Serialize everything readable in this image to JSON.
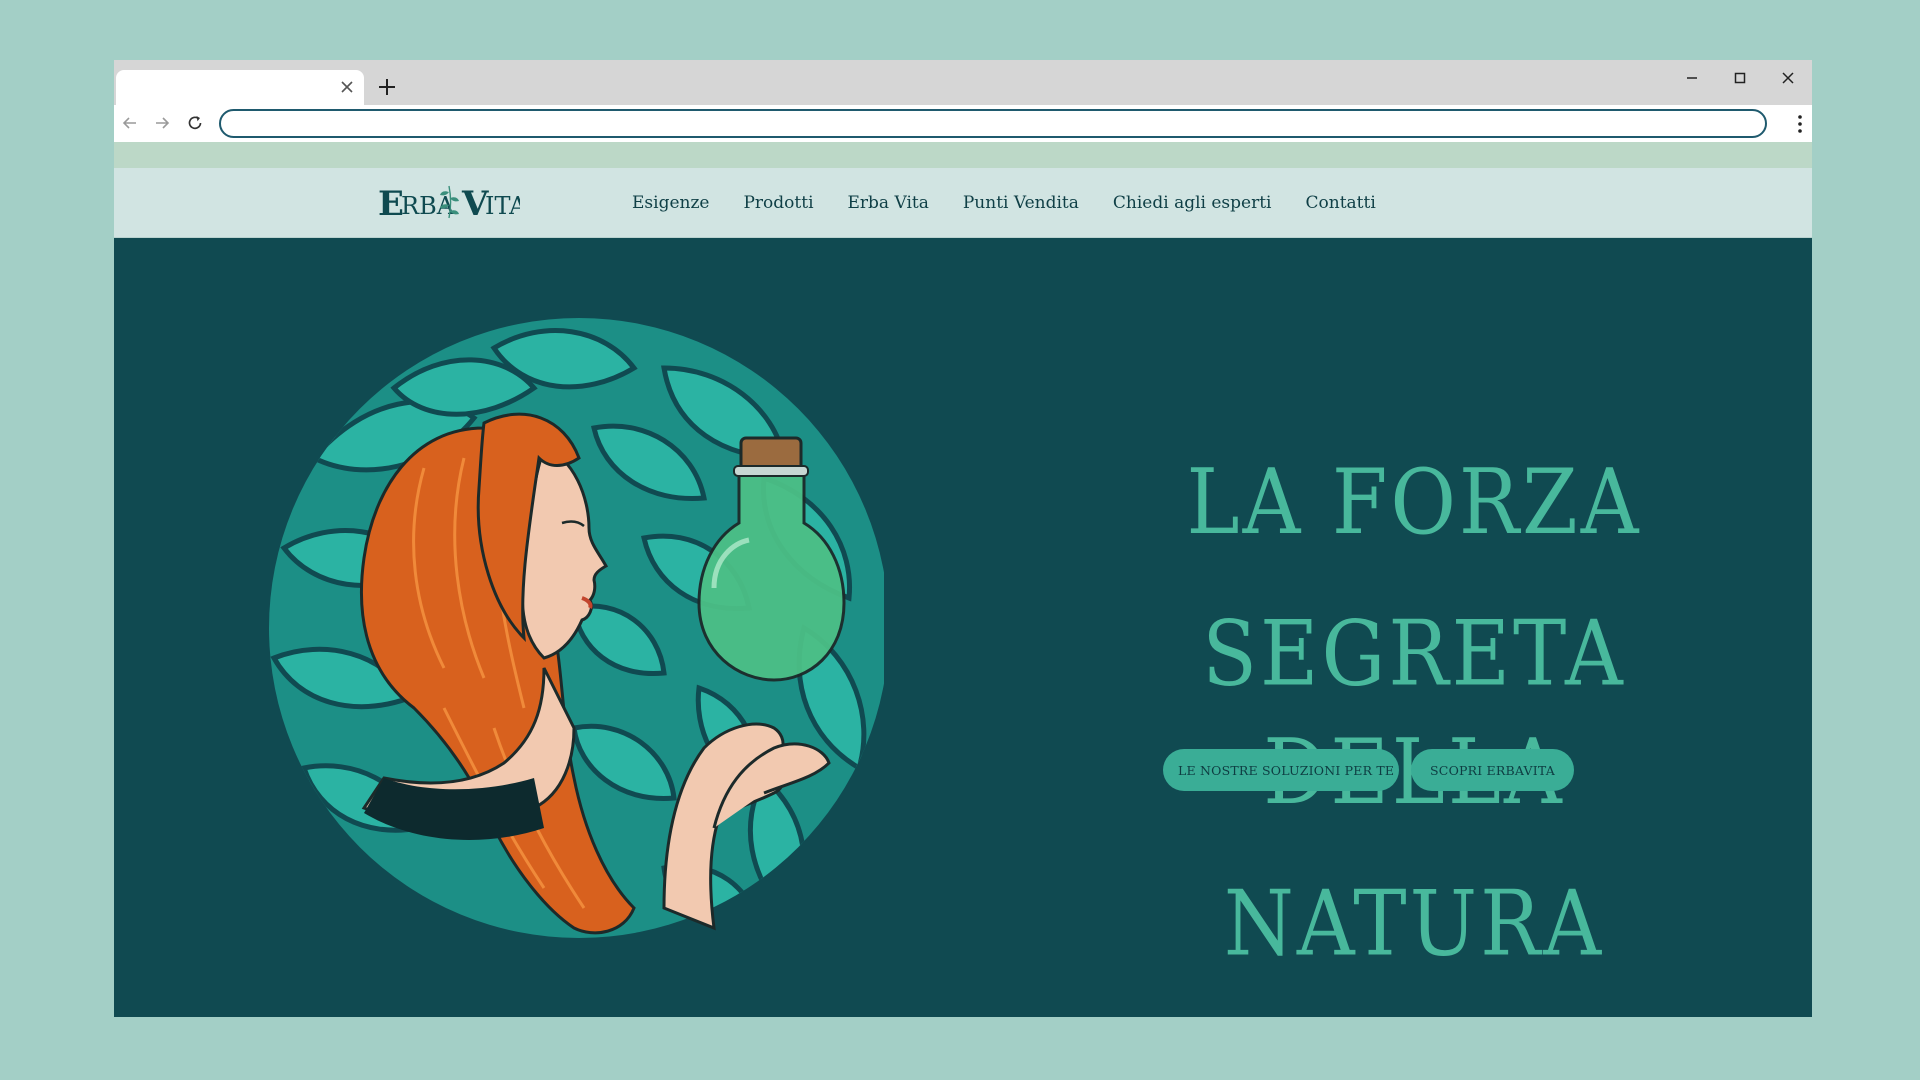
{
  "browser": {
    "tab_title": "",
    "url": "",
    "icons": {
      "tab_close": "close-icon",
      "new_tab": "plus-icon",
      "minimize": "minimize-icon",
      "maximize": "maximize-icon",
      "close": "close-icon",
      "back": "arrow-left-icon",
      "forward": "arrow-right-icon",
      "reload": "reload-icon",
      "menu": "kebab-menu-icon"
    }
  },
  "site": {
    "logo_text": "ErbaVita",
    "nav": [
      {
        "label": "Esigenze"
      },
      {
        "label": "Prodotti"
      },
      {
        "label": "Erba Vita"
      },
      {
        "label": "Punti Vendita"
      },
      {
        "label": "Chiedi agli esperti"
      },
      {
        "label": "Contatti"
      }
    ],
    "hero": {
      "headline_line1": "La forza segreta",
      "headline_line2": "della Natura",
      "cta_primary": "LE NOSTRE SOLUZIONI PER TE",
      "cta_secondary": "SCOPRI ERBAVITA"
    },
    "colors": {
      "hero_background": "#104a51",
      "header_background": "#d1e4e2",
      "top_band": "#bcd8c7",
      "accent": "#48b89c",
      "button": "#3aad96",
      "leaves": "#25a79a",
      "hair": "#d8611e",
      "page_background": "#a3cfc6"
    }
  }
}
